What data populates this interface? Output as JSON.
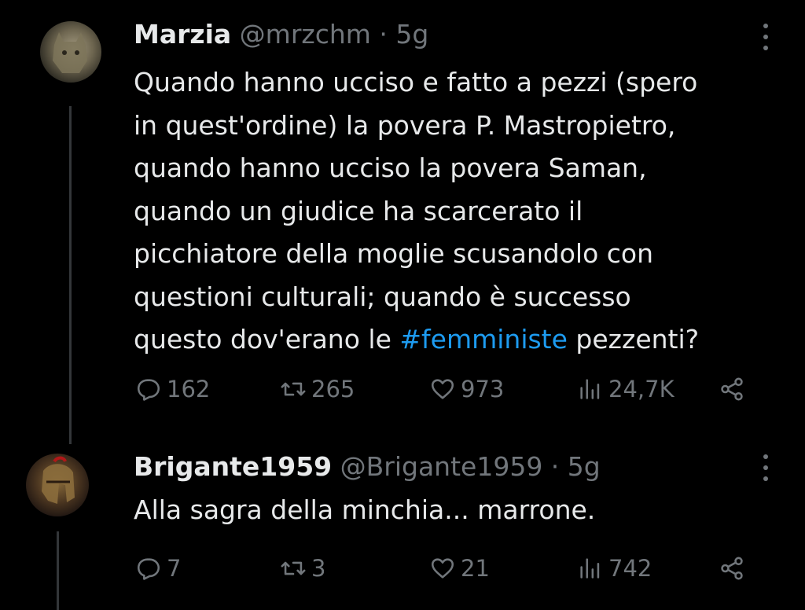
{
  "tweets": [
    {
      "display_name": "Marzia",
      "handle": "@mrzchm",
      "time": "5g",
      "text_lines": [
        "Quando hanno ucciso e fatto a pezzi (spero",
        "in quest'ordine) la povera P. Mastropietro,",
        "quando hanno ucciso la povera Saman,",
        "quando un giudice ha scarcerato il",
        "picchiatore della moglie scusandolo con",
        "questioni culturali; quando è successo"
      ],
      "last_line_before": "questo dov'erano le ",
      "hashtag": "#femministe",
      "last_line_after": " pezzenti?",
      "stats": {
        "replies": "162",
        "retweets": "265",
        "likes": "973",
        "views": "24,7K"
      }
    },
    {
      "display_name": "Brigante1959",
      "handle": "@Brigante1959",
      "time": "5g",
      "text": "Alla sagra della minchia... marrone.",
      "stats": {
        "replies": "7",
        "retweets": "3",
        "likes": "21",
        "views": "742"
      }
    }
  ],
  "separator": " · ",
  "icons": [
    "reply-icon",
    "retweet-icon",
    "like-icon",
    "views-icon",
    "share-icon",
    "more-icon"
  ],
  "colors": {
    "background": "#000000",
    "text": "#e7e9ea",
    "muted": "#71767b",
    "link": "#1d9bf0"
  }
}
